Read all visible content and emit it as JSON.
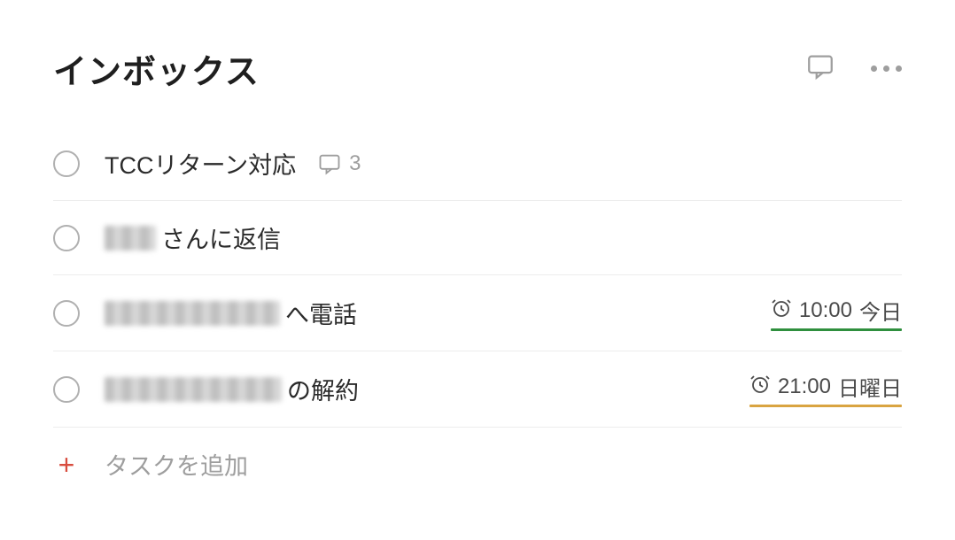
{
  "header": {
    "title": "インボックス"
  },
  "tasks": [
    {
      "title": "TCCリターン対応",
      "comment_count": "3",
      "has_redacted": false
    },
    {
      "title_suffix": "さんに返信",
      "redacted_width": 58,
      "has_redacted": true
    },
    {
      "title_suffix": "へ電話",
      "redacted_width": 198,
      "has_redacted": true,
      "due": {
        "time": "10:00",
        "day": "今日",
        "color": "green"
      }
    },
    {
      "title_suffix": "の解約",
      "redacted_width": 200,
      "has_redacted": true,
      "due": {
        "time": "21:00",
        "day": "日曜日",
        "color": "orange"
      }
    }
  ],
  "add_task": {
    "label": "タスクを追加"
  }
}
